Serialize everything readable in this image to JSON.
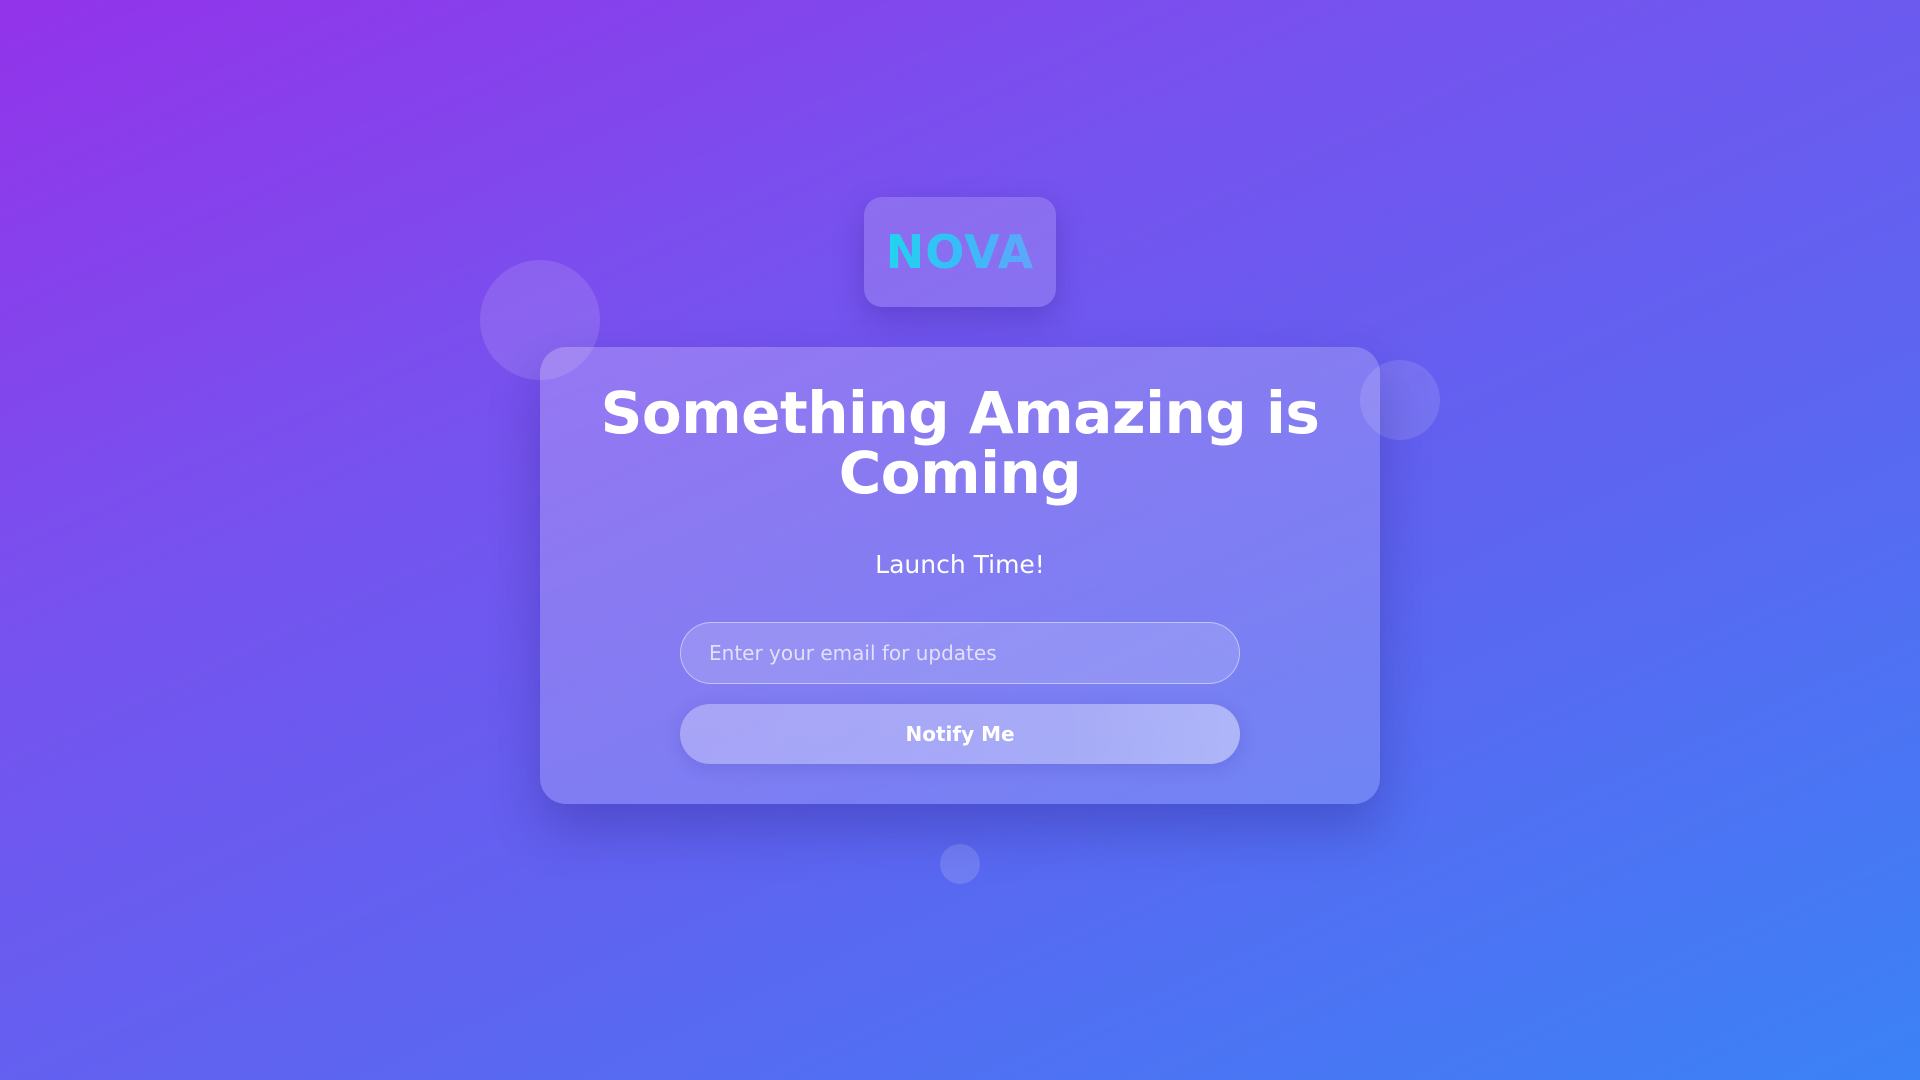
{
  "brand": {
    "logo_text": "NOVA",
    "logo_gradient": [
      "#22d3ee",
      "#60a5fa"
    ]
  },
  "hero": {
    "title": "Something Amazing is Coming",
    "subtitle": "Launch Time!"
  },
  "signup": {
    "email_placeholder": "Enter your email for updates",
    "email_value": "",
    "button_label": "Notify Me"
  },
  "colors": {
    "background_start": "#9333ea",
    "background_end": "#3b82f6",
    "text": "#ffffff"
  }
}
